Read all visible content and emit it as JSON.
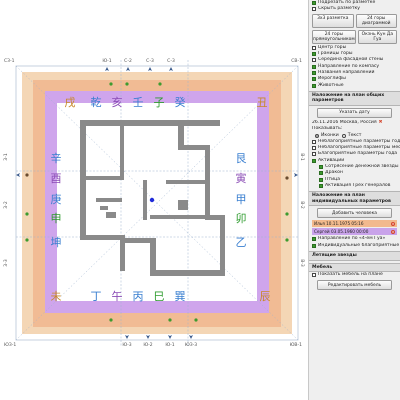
{
  "compass": {
    "corner_labels": [
      "СЗ-1",
      "СВ-1",
      "ЮЗ-1",
      "ЮВ-1"
    ],
    "top_sectors": [
      "Ю-1",
      "С-2",
      "С-3",
      "С-3"
    ],
    "bottom_sectors": [
      "Ю-3",
      "Ю-2",
      "Ю-1",
      "ЮЗ-3"
    ],
    "left_sectors": [
      "З-1",
      "З-2",
      "З-3"
    ],
    "right_sectors": [
      "В-1",
      "В-2",
      "В-3"
    ],
    "ring_top": [
      "戌",
      "乾",
      "亥",
      "壬",
      "子",
      "癸",
      "丑"
    ],
    "ring_bottom": [
      "未",
      "丁",
      "午",
      "丙",
      "巳",
      "巽",
      "辰"
    ],
    "ring_left": [
      "辛",
      "酉",
      "庚",
      "申",
      "坤"
    ],
    "ring_right": [
      "艮",
      "寅",
      "甲",
      "卯",
      "乙"
    ],
    "colors": {
      "ring_outer": "#f4d6b5",
      "ring_mid": "#f1bb94",
      "ring_inner": "#cfa5ec",
      "char_blue": "#3a7fd0",
      "char_green": "#2f9c2f",
      "char_orange": "#c8892a",
      "char_purple": "#8a4bb5",
      "char_red": "#d4462e",
      "wall": "#8a8a8a"
    }
  },
  "panel": {
    "options": [
      {
        "label": "Подрезать по разметке",
        "checked": true
      },
      {
        "label": "Скрыть разметку",
        "checked": false
      }
    ],
    "grid_buttons": [
      "3x3 разметка",
      "24 горы диаграммой",
      "24 горы прямоугольником",
      "Окзнь Кун Да Гуа"
    ],
    "layers": [
      {
        "label": "Центр горы",
        "checked": false
      },
      {
        "label": "Границы горы",
        "checked": true
      },
      {
        "label": "Середина фасадной стены",
        "checked": false
      },
      {
        "label": "Направление по компасу",
        "checked": true
      },
      {
        "label": "Названия направлений",
        "checked": true
      },
      {
        "label": "Иероглифы",
        "checked": true
      },
      {
        "label": "Животные",
        "checked": true
      }
    ],
    "general_header": "Наложение на план общих параметров",
    "date_button": "Указать дату",
    "date_text": "26.11.2016 Москва, Россия",
    "show_label": "Показывать:",
    "show_options": [
      {
        "label": "Иконки",
        "checked": true
      },
      {
        "label": "Текст",
        "checked": false
      }
    ],
    "general_options": [
      {
        "label": "Неблагоприятные параметры года",
        "checked": false,
        "indent": false
      },
      {
        "label": "Неблагоприятные параметры месяца",
        "checked": false,
        "indent": false
      },
      {
        "label": "Благоприятные параметры года",
        "checked": false,
        "indent": false
      },
      {
        "label": "Активации",
        "checked": true,
        "indent": false
      },
      {
        "label": "Сотрясение денежной звезды",
        "checked": true,
        "indent": true
      },
      {
        "label": "Дракон",
        "checked": true,
        "indent": true
      },
      {
        "label": "Птица",
        "checked": true,
        "indent": true
      },
      {
        "label": "Активация Трёх генералов",
        "checked": true,
        "indent": true
      }
    ],
    "individual_header": "Наложение на план индивидуальных параметров",
    "add_person_button": "Добавить человека",
    "people": [
      {
        "name": "Илья 10.11.1975 05:16",
        "color": "#f2b98d"
      },
      {
        "name": "Сергей 03.05.1960 00:00",
        "color": "#c9a3ea"
      }
    ],
    "individual_options": [
      {
        "label": "Направление по «4-ём Гуа»",
        "checked": true
      },
      {
        "label": "Индивидуальные благоприятные параметры",
        "checked": true
      }
    ],
    "stars_header": "Летящие звезды",
    "furniture_header": "Мебель",
    "furniture_options": [
      {
        "label": "Показать мебель на плане",
        "checked": false
      }
    ],
    "edit_furniture_button": "Редактировать мебель"
  }
}
